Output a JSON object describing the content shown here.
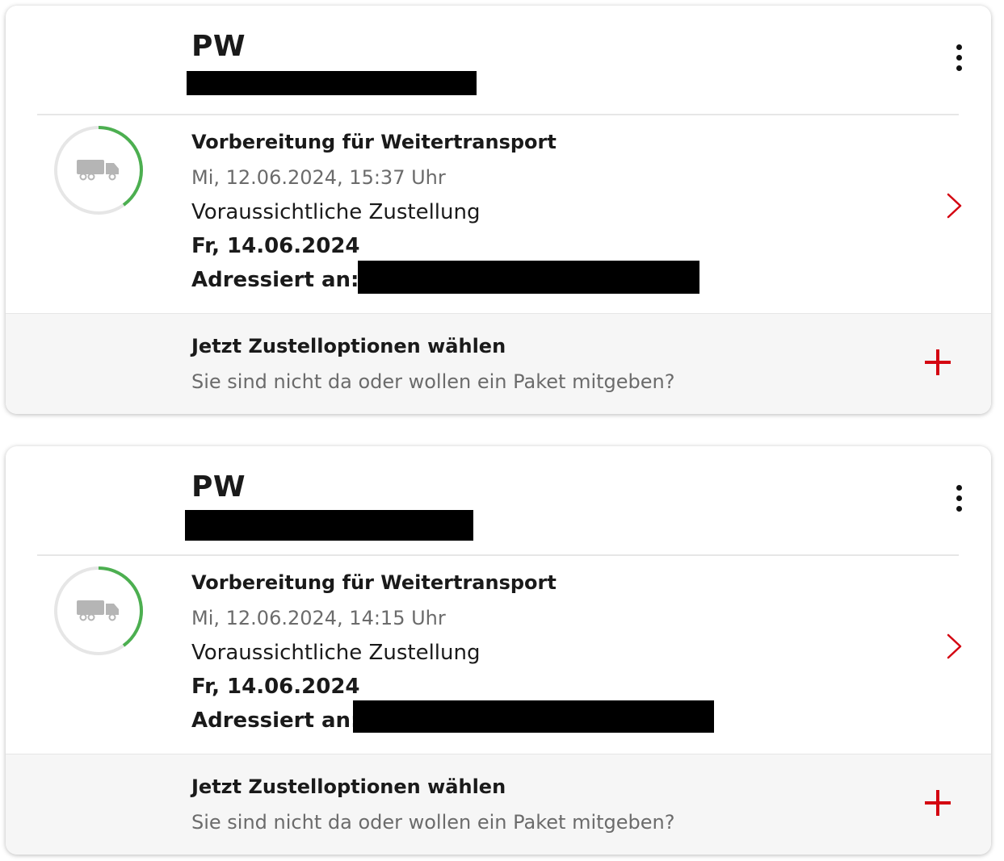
{
  "colors": {
    "accent_red": "#d40511",
    "progress_green": "#4caf50",
    "progress_track": "#e6e6e6",
    "truck_gray": "#b5b5b5",
    "redaction": "#000000"
  },
  "shipments": [
    {
      "sender": "PW",
      "status_title": "Vorbereitung für Weitertransport",
      "status_time": "Mi, 12.06.2024, 15:37 Uhr",
      "eta_label": "Voraussichtliche Zustellung",
      "eta_date": "Fr, 14.06.2024",
      "addressed_label": "Adressiert an:",
      "progress_fraction": 0.4,
      "status_icon": "truck-icon",
      "options_title": "Jetzt Zustelloptionen wählen",
      "options_subtitle": "Sie sind nicht da oder wollen ein Paket mitgeben?"
    },
    {
      "sender": "PW",
      "status_title": "Vorbereitung für Weitertransport",
      "status_time": "Mi, 12.06.2024, 14:15 Uhr",
      "eta_label": "Voraussichtliche Zustellung",
      "eta_date": "Fr, 14.06.2024",
      "addressed_label": "Adressiert an:",
      "progress_fraction": 0.4,
      "status_icon": "truck-icon",
      "options_title": "Jetzt Zustelloptionen wählen",
      "options_subtitle": "Sie sind nicht da oder wollen ein Paket mitgeben?"
    }
  ]
}
